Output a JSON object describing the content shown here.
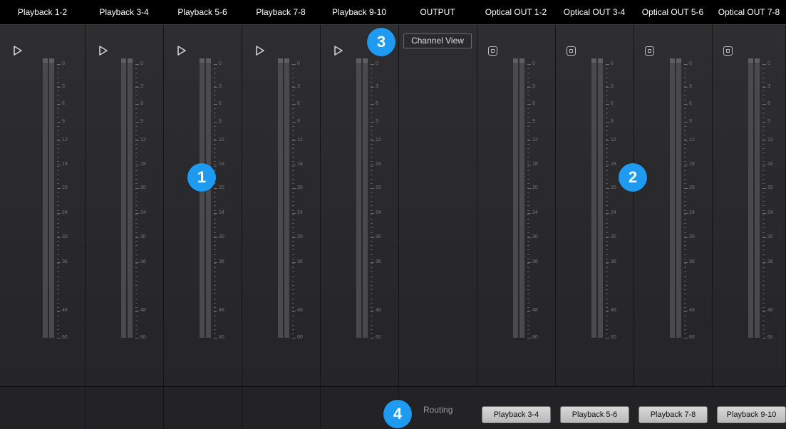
{
  "header": {
    "columns": [
      {
        "label": "Playback 1-2"
      },
      {
        "label": "Playback 3-4"
      },
      {
        "label": "Playback 5-6"
      },
      {
        "label": "Playback 7-8"
      },
      {
        "label": "Playback 9-10"
      },
      {
        "label": "OUTPUT"
      },
      {
        "label": "Optical OUT 1-2"
      },
      {
        "label": "Optical OUT 3-4"
      },
      {
        "label": "Optical OUT 5-6"
      },
      {
        "label": "Optical OUT 7-8"
      }
    ]
  },
  "playback_icon": "play-icon",
  "output_icon": "stop-icon",
  "meter_scale_labels": [
    "0",
    "3",
    "6",
    "9",
    "12",
    "18",
    "20",
    "24",
    "30",
    "36",
    "48",
    "60"
  ],
  "output": {
    "channel_view_label": "Channel View",
    "routing_label": "Routing"
  },
  "routing_buttons": [
    {
      "label": "Playback 3-4"
    },
    {
      "label": "Playback 5-6"
    },
    {
      "label": "Playback 7-8"
    },
    {
      "label": "Playback 9-10"
    }
  ],
  "callouts": [
    {
      "number": "1"
    },
    {
      "number": "2"
    },
    {
      "number": "3"
    },
    {
      "number": "4"
    }
  ],
  "colors": {
    "background": "#262628",
    "header": "#000000",
    "callout": "#1e9bf0",
    "meter": "#4a4a4c",
    "button": "#cfcfcf"
  }
}
